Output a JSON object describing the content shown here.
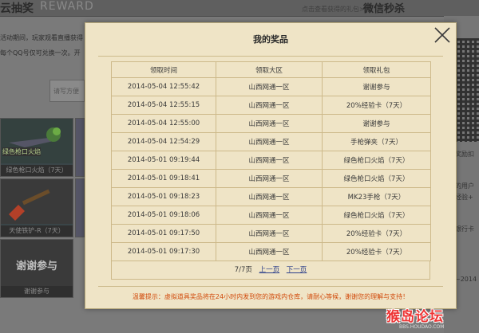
{
  "background": {
    "lottery_title": "云抽奖",
    "reward_title": "REWARD",
    "view_gift_link": "点击查看获得的礼包>>",
    "wechat_title": "微信秒杀",
    "info_lines": [
      "活动期间，玩家观看直播获得",
      "每个QQ号仅可兑换一次。开"
    ],
    "code_input_placeholder": "请写方便",
    "tiles": [
      {
        "caption": "绿色枪口火焰（7天）"
      },
      {
        "caption": "天使铁铲-R（7天）"
      },
      {
        "caption": "谢谢参与",
        "big_text": "谢谢参与"
      }
    ],
    "tile_badge": "绿色枪口火焰",
    "right_texts": [
      "奖励扣",
      "的用户",
      "经验+",
      "银行卡",
      "~2014"
    ]
  },
  "modal": {
    "title": "我的奖品",
    "columns": [
      "领取时间",
      "领取大区",
      "领取礼包"
    ],
    "rows": [
      [
        "2014-05-04 12:55:42",
        "山西网通一区",
        "谢谢参与"
      ],
      [
        "2014-05-04 12:55:15",
        "山西网通一区",
        "20%经验卡（7天）"
      ],
      [
        "2014-05-04 12:55:00",
        "山西网通一区",
        "谢谢参与"
      ],
      [
        "2014-05-04 12:54:29",
        "山西网通一区",
        "手枪弹夹（7天）"
      ],
      [
        "2014-05-01 09:19:44",
        "山西网通一区",
        "绿色枪口火焰（7天）"
      ],
      [
        "2014-05-01 09:18:41",
        "山西网通一区",
        "绿色枪口火焰（7天）"
      ],
      [
        "2014-05-01 09:18:23",
        "山西网通一区",
        "MK23手枪（7天）"
      ],
      [
        "2014-05-01 09:18:06",
        "山西网通一区",
        "绿色枪口火焰（7天）"
      ],
      [
        "2014-05-01 09:17:50",
        "山西网通一区",
        "20%经验卡（7天）"
      ],
      [
        "2014-05-01 09:17:30",
        "山西网通一区",
        "20%经验卡（7天）"
      ]
    ],
    "pager": {
      "page_info": "7/7页",
      "prev": "上一页",
      "next": "下一页"
    },
    "tip": "温馨提示：虚拟道具奖品将在24小时内发到您的游戏内仓库，请耐心等候，谢谢您的理解与支持！"
  },
  "watermark": {
    "logo": "猴岛论坛",
    "url": "BBS.HOUDAO.COM"
  },
  "colors": {
    "modal_bg": "#efe4c6",
    "tip": "#d14a0b",
    "link": "#2c3f8a"
  },
  "icons": {
    "close": "close-icon"
  }
}
